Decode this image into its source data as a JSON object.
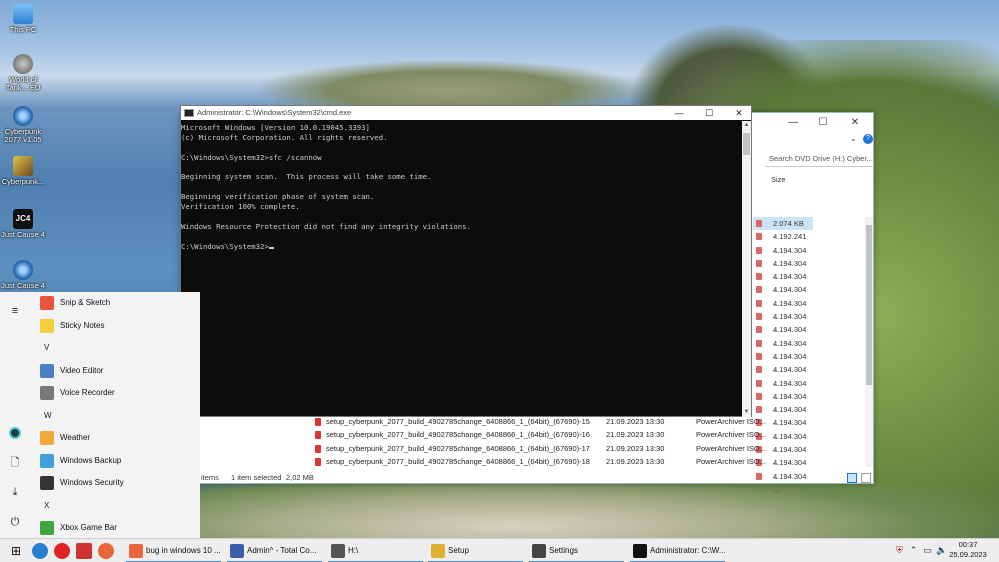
{
  "desktop": {
    "icons": [
      {
        "label": "This PC",
        "icon": "computer-icon"
      },
      {
        "label": "World of Tank... EU",
        "icon": "tank-icon"
      },
      {
        "label": "Cyberpunk 2077 v1.05",
        "icon": "cyberpunk-icon"
      },
      {
        "label": "Cyberpunk...",
        "icon": "cyberpunk-icon"
      },
      {
        "label": "Just Cause 4",
        "icon": "jc4-icon"
      },
      {
        "label": "Just Cause 4",
        "icon": "cyberpunk-icon"
      }
    ]
  },
  "cmd": {
    "title": "Administrator: C:\\Windows\\System32\\cmd.exe",
    "lines": [
      "Microsoft Windows [Version 10.0.19045.3393]",
      "(c) Microsoft Corporation. All rights reserved.",
      "",
      "C:\\Windows\\System32>sfc /scannow",
      "",
      "Beginning system scan.  This process will take some time.",
      "",
      "Beginning verification phase of system scan.",
      "Verification 100% complete.",
      "",
      "Windows Resource Protection did not find any integrity violations.",
      "",
      "C:\\Windows\\System32>"
    ]
  },
  "explorer": {
    "search_placeholder": "Search DVD Drive (H:) Cyber...",
    "size_header": "Size",
    "sizes": [
      "2.074 KB",
      "4.192.241 ...",
      "4.194.304 ...",
      "4.194.304 ...",
      "4.194.304 ...",
      "4.194.304 ...",
      "4.194.304 ...",
      "4.194.304 ...",
      "4.194.304 ...",
      "4.194.304 ...",
      "4.194.304 ...",
      "4.194.304 ...",
      "4.194.304 ...",
      "4.194.304 ...",
      "4.194.304 ...",
      "4.194.304 ...",
      "4.194.304 ...",
      "4.194.304 ...",
      "4.194.304 ...",
      "4.194.304 ..."
    ],
    "files": [
      {
        "name": "setup_cyberpunk_2077_build_4902785change_6408866_1_(64bit)_(67690)-15",
        "date": "21.09.2023 13:30",
        "type": "PowerArchiver ISO..."
      },
      {
        "name": "setup_cyberpunk_2077_build_4902785change_6408866_1_(64bit)_(67690)-16",
        "date": "21.09.2023 13:30",
        "type": "PowerArchiver ISO..."
      },
      {
        "name": "setup_cyberpunk_2077_build_4902785change_6408866_1_(64bit)_(67690)-17",
        "date": "21.09.2023 13:30",
        "type": "PowerArchiver ISO..."
      },
      {
        "name": "setup_cyberpunk_2077_build_4902785change_6408866_1_(64bit)_(67690)-18",
        "date": "21.09.2023 13:30",
        "type": "PowerArchiver ISO..."
      }
    ],
    "status_items": "items",
    "status_selected": "1 item selected",
    "status_size": "2,02 MB"
  },
  "start_menu": {
    "entries": [
      {
        "kind": "app",
        "label": "Snip & Sketch",
        "color": "#e8553f"
      },
      {
        "kind": "app",
        "label": "Sticky Notes",
        "color": "#f2cf3c"
      },
      {
        "kind": "letter",
        "label": "V"
      },
      {
        "kind": "app",
        "label": "Video Editor",
        "color": "#4a7fc4"
      },
      {
        "kind": "app",
        "label": "Voice Recorder",
        "color": "#777777"
      },
      {
        "kind": "letter",
        "label": "W"
      },
      {
        "kind": "app",
        "label": "Weather",
        "color": "#f2a93c"
      },
      {
        "kind": "app",
        "label": "Windows Backup",
        "color": "#3fa0d8"
      },
      {
        "kind": "app",
        "label": "Windows Security",
        "color": "#333333"
      },
      {
        "kind": "letter",
        "label": "X"
      },
      {
        "kind": "app",
        "label": "Xbox Game Bar",
        "color": "#3fa63f"
      }
    ]
  },
  "taskbar": {
    "tasks": [
      {
        "label": "bug in windows 10 ...",
        "icon": "firefox-icon",
        "color": "#e8663c"
      },
      {
        "label": "Admin^ - Total Co...",
        "icon": "floppy-icon",
        "color": "#3a5fa8"
      },
      {
        "label": "H:\\",
        "icon": "drive-icon",
        "color": "#555555"
      },
      {
        "label": "Setup",
        "icon": "setup-icon",
        "color": "#e0b030"
      },
      {
        "label": "Settings",
        "icon": "gear-icon",
        "color": "#444444"
      },
      {
        "label": "Administrator: C:\\W...",
        "icon": "cmd-icon",
        "color": "#111111"
      }
    ],
    "time": "00:37",
    "date": "25.09.2023"
  }
}
